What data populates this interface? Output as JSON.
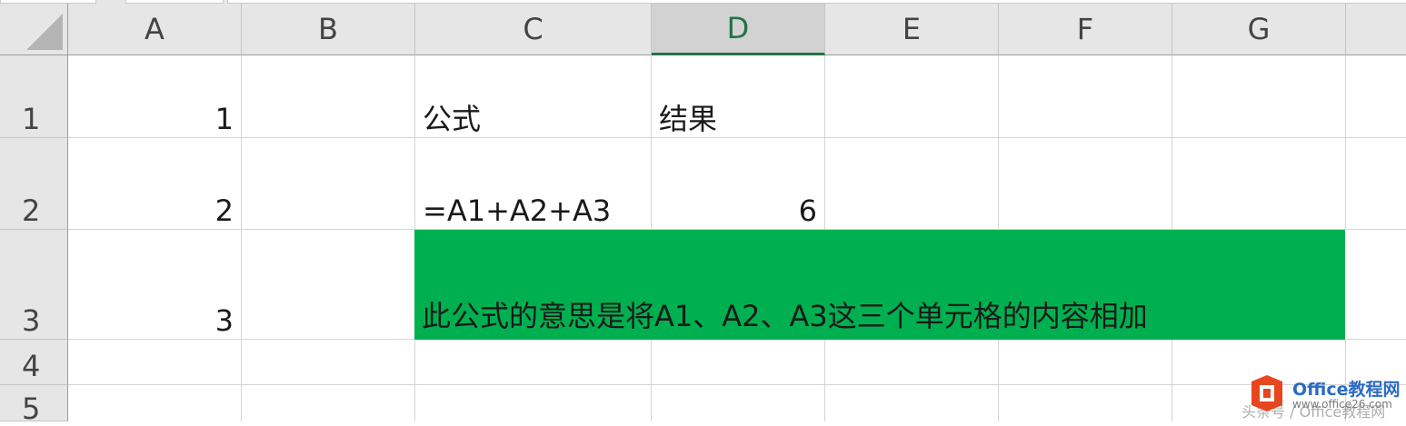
{
  "columns": [
    "A",
    "B",
    "C",
    "D",
    "E",
    "F",
    "G"
  ],
  "selected_column": "D",
  "rows": [
    "1",
    "2",
    "3",
    "4",
    "5"
  ],
  "cells": {
    "A1": "1",
    "A2": "2",
    "A3": "3",
    "C1": "公式",
    "D1": "结果",
    "C2": "=A1+A2+A3",
    "D2": "6",
    "C3": "此公式的意思是将A1、A2、A3这三个单元格的内容相加"
  },
  "fill_color_C3_G3": "#00b050",
  "watermark": {
    "brand": "Office教程网",
    "url": "www.office26.com",
    "faint": "头条号 / Office教程网"
  },
  "colors": {
    "header_bg": "#e6e6e6",
    "selected_header_text": "#217346",
    "grid_line": "#d4d4d4"
  }
}
